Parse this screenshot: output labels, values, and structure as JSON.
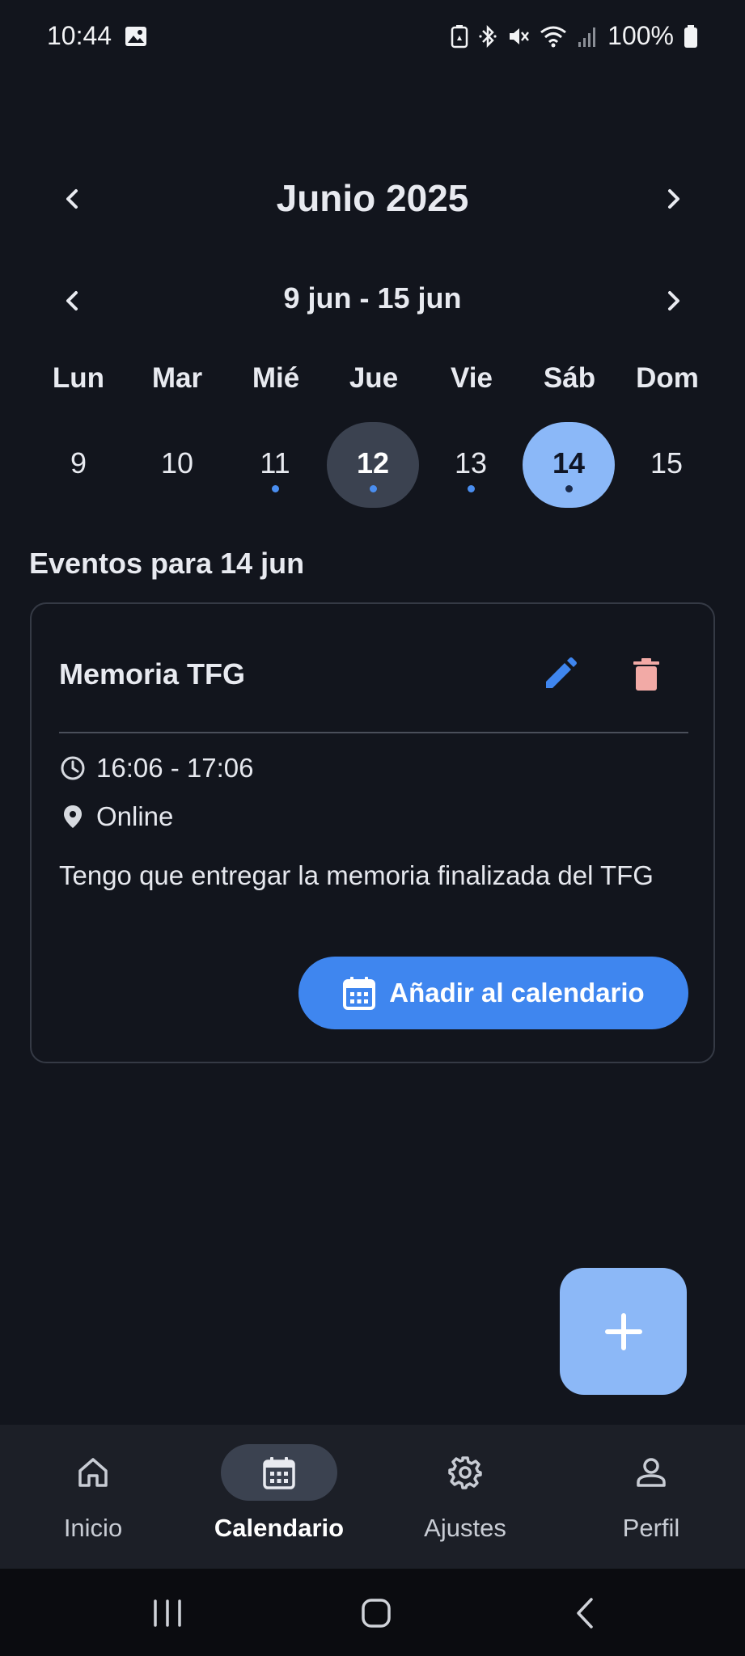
{
  "status_bar": {
    "time": "10:44",
    "battery": "100%",
    "icons": [
      "image-icon",
      "battery-saver-icon",
      "bluetooth-icon",
      "mute-icon",
      "wifi-icon",
      "signal-icon",
      "battery-icon"
    ]
  },
  "calendar": {
    "month_title": "Junio 2025",
    "week_range": "9 jun - 15 jun",
    "weekdays": [
      "Lun",
      "Mar",
      "Mié",
      "Jue",
      "Vie",
      "Sáb",
      "Dom"
    ],
    "dates": [
      {
        "day": "9",
        "has_event": false,
        "today": false,
        "selected": false
      },
      {
        "day": "10",
        "has_event": false,
        "today": false,
        "selected": false
      },
      {
        "day": "11",
        "has_event": true,
        "today": false,
        "selected": false
      },
      {
        "day": "12",
        "has_event": true,
        "today": true,
        "selected": false
      },
      {
        "day": "13",
        "has_event": true,
        "today": false,
        "selected": false
      },
      {
        "day": "14",
        "has_event": true,
        "today": false,
        "selected": true
      },
      {
        "day": "15",
        "has_event": false,
        "today": false,
        "selected": false
      }
    ]
  },
  "events": {
    "heading": "Eventos para 14 jun",
    "items": [
      {
        "title": "Memoria TFG",
        "time": "16:06 - 17:06",
        "location": "Online",
        "description": "Tengo que entregar la memoria finalizada del TFG",
        "add_button_label": "Añadir al calendario"
      }
    ]
  },
  "bottom_nav": {
    "items": [
      {
        "label": "Inicio",
        "icon": "home-icon",
        "active": false
      },
      {
        "label": "Calendario",
        "icon": "calendar-icon",
        "active": true
      },
      {
        "label": "Ajustes",
        "icon": "gear-icon",
        "active": false
      },
      {
        "label": "Perfil",
        "icon": "person-icon",
        "active": false
      }
    ]
  },
  "colors": {
    "background": "#12151d",
    "accent": "#3f86ef",
    "selected_day": "#8bb8f8",
    "today_day": "#3b4250",
    "delete": "#f2aaa6",
    "fab": "#8cb8f7"
  }
}
